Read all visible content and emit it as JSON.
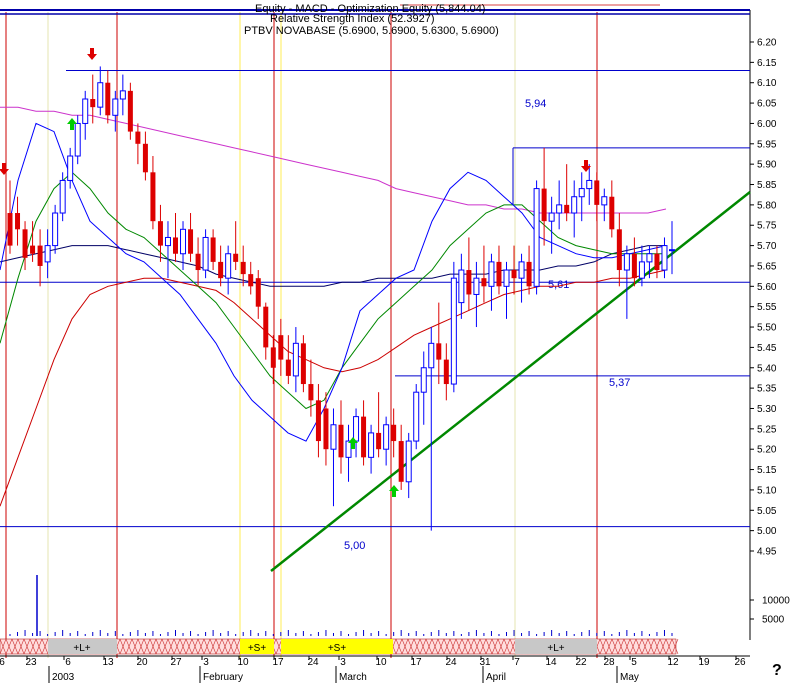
{
  "chart_data": {
    "type": "candlestick",
    "title_lines": [
      "Equity - MACD - Optimization Equity (5,844.04)",
      "Relative Strength Index (52.3927)",
      "PTBV NOVABASE (5.6900, 5.6900, 5.6300, 5.6900)"
    ],
    "y_ticks": [
      "6.20",
      "6.15",
      "6.10",
      "6.05",
      "6.00",
      "5.95",
      "5.90",
      "5.85",
      "5.80",
      "5.75",
      "5.70",
      "5.65",
      "5.60",
      "5.55",
      "5.50",
      "5.45",
      "5.40",
      "5.35",
      "5.30",
      "5.25",
      "5.20",
      "5.15",
      "5.10",
      "5.05",
      "5.00",
      "4.95"
    ],
    "ylim": [
      4.92,
      6.24
    ],
    "volume_ticks": [
      "10000",
      "5000"
    ],
    "x_day_labels": [
      "6",
      "23",
      "6",
      "13",
      "20",
      "27",
      "3",
      "10",
      "17",
      "24",
      "3",
      "10",
      "17",
      "24",
      "31",
      "7",
      "14",
      "22",
      "28",
      "5",
      "12",
      "19",
      "26"
    ],
    "x_month_labels": [
      "2003",
      "February",
      "March",
      "April",
      "May"
    ],
    "band_labels": [
      "+L+",
      "+S+",
      "+S+",
      "+L+"
    ],
    "levels": [
      {
        "value": 6.13,
        "label": ""
      },
      {
        "value": 5.94,
        "label": "5,94"
      },
      {
        "value": 5.61,
        "label": "5,61"
      },
      {
        "value": 5.38,
        "label": "5,37"
      },
      {
        "value": 5.01,
        "label": "5,00"
      }
    ],
    "trendline": {
      "start": {
        "day": 39,
        "price": 4.88
      },
      "end": {
        "day": 122,
        "price": 5.8
      }
    },
    "candles": [
      {
        "o": 5.78,
        "h": 5.86,
        "l": 5.68,
        "c": 5.7
      },
      {
        "o": 5.78,
        "h": 5.82,
        "l": 5.7,
        "c": 5.74
      },
      {
        "o": 5.74,
        "h": 5.76,
        "l": 5.64,
        "c": 5.67
      },
      {
        "o": 5.7,
        "h": 5.76,
        "l": 5.66,
        "c": 5.68
      },
      {
        "o": 5.7,
        "h": 5.74,
        "l": 5.6,
        "c": 5.65
      },
      {
        "o": 5.66,
        "h": 5.74,
        "l": 5.62,
        "c": 5.7
      },
      {
        "o": 5.7,
        "h": 5.8,
        "l": 5.68,
        "c": 5.78
      },
      {
        "o": 5.78,
        "h": 5.88,
        "l": 5.76,
        "c": 5.86
      },
      {
        "o": 5.86,
        "h": 5.94,
        "l": 5.84,
        "c": 5.92
      },
      {
        "o": 5.92,
        "h": 6.02,
        "l": 5.9,
        "c": 6.0
      },
      {
        "o": 6.0,
        "h": 6.08,
        "l": 5.96,
        "c": 6.06
      },
      {
        "o": 6.06,
        "h": 6.12,
        "l": 6.0,
        "c": 6.04
      },
      {
        "o": 6.04,
        "h": 6.14,
        "l": 6.02,
        "c": 6.1
      },
      {
        "o": 6.1,
        "h": 6.13,
        "l": 6.0,
        "c": 6.02
      },
      {
        "o": 6.02,
        "h": 6.08,
        "l": 5.98,
        "c": 6.06
      },
      {
        "o": 6.06,
        "h": 6.12,
        "l": 6.02,
        "c": 6.08
      },
      {
        "o": 6.08,
        "h": 6.1,
        "l": 5.96,
        "c": 5.98
      },
      {
        "o": 5.98,
        "h": 6.0,
        "l": 5.9,
        "c": 5.95
      },
      {
        "o": 5.95,
        "h": 5.98,
        "l": 5.86,
        "c": 5.88
      },
      {
        "o": 5.88,
        "h": 5.92,
        "l": 5.74,
        "c": 5.76
      },
      {
        "o": 5.76,
        "h": 5.8,
        "l": 5.66,
        "c": 5.7
      },
      {
        "o": 5.7,
        "h": 5.76,
        "l": 5.62,
        "c": 5.72
      },
      {
        "o": 5.72,
        "h": 5.78,
        "l": 5.66,
        "c": 5.68
      },
      {
        "o": 5.68,
        "h": 5.76,
        "l": 5.64,
        "c": 5.74
      },
      {
        "o": 5.74,
        "h": 5.78,
        "l": 5.66,
        "c": 5.68
      },
      {
        "o": 5.68,
        "h": 5.72,
        "l": 5.6,
        "c": 5.64
      },
      {
        "o": 5.64,
        "h": 5.74,
        "l": 5.62,
        "c": 5.72
      },
      {
        "o": 5.72,
        "h": 5.74,
        "l": 5.64,
        "c": 5.66
      },
      {
        "o": 5.66,
        "h": 5.7,
        "l": 5.6,
        "c": 5.62
      },
      {
        "o": 5.62,
        "h": 5.7,
        "l": 5.58,
        "c": 5.68
      },
      {
        "o": 5.68,
        "h": 5.76,
        "l": 5.64,
        "c": 5.66
      },
      {
        "o": 5.66,
        "h": 5.7,
        "l": 5.6,
        "c": 5.63
      },
      {
        "o": 5.63,
        "h": 5.66,
        "l": 5.58,
        "c": 5.6
      },
      {
        "o": 5.62,
        "h": 5.64,
        "l": 5.52,
        "c": 5.55
      },
      {
        "o": 5.55,
        "h": 5.56,
        "l": 5.42,
        "c": 5.45
      },
      {
        "o": 5.45,
        "h": 5.48,
        "l": 5.36,
        "c": 5.4
      },
      {
        "o": 5.48,
        "h": 5.52,
        "l": 5.38,
        "c": 5.42
      },
      {
        "o": 5.42,
        "h": 5.48,
        "l": 5.36,
        "c": 5.38
      },
      {
        "o": 5.38,
        "h": 5.5,
        "l": 5.34,
        "c": 5.46
      },
      {
        "o": 5.46,
        "h": 5.48,
        "l": 5.34,
        "c": 5.36
      },
      {
        "o": 5.36,
        "h": 5.42,
        "l": 5.28,
        "c": 5.32
      },
      {
        "o": 5.32,
        "h": 5.36,
        "l": 5.18,
        "c": 5.22
      },
      {
        "o": 5.3,
        "h": 5.34,
        "l": 5.16,
        "c": 5.2
      },
      {
        "o": 5.2,
        "h": 5.3,
        "l": 5.06,
        "c": 5.26
      },
      {
        "o": 5.26,
        "h": 5.32,
        "l": 5.14,
        "c": 5.18
      },
      {
        "o": 5.18,
        "h": 5.26,
        "l": 5.12,
        "c": 5.22
      },
      {
        "o": 5.22,
        "h": 5.3,
        "l": 5.18,
        "c": 5.28
      },
      {
        "o": 5.28,
        "h": 5.32,
        "l": 5.16,
        "c": 5.18
      },
      {
        "o": 5.18,
        "h": 5.26,
        "l": 5.14,
        "c": 5.24
      },
      {
        "o": 5.24,
        "h": 5.34,
        "l": 5.18,
        "c": 5.2
      },
      {
        "o": 5.2,
        "h": 5.28,
        "l": 5.16,
        "c": 5.26
      },
      {
        "o": 5.26,
        "h": 5.3,
        "l": 5.18,
        "c": 5.22
      },
      {
        "o": 5.22,
        "h": 5.26,
        "l": 5.1,
        "c": 5.12
      },
      {
        "o": 5.12,
        "h": 5.24,
        "l": 5.08,
        "c": 5.22
      },
      {
        "o": 5.22,
        "h": 5.36,
        "l": 5.2,
        "c": 5.34
      },
      {
        "o": 5.34,
        "h": 5.44,
        "l": 5.26,
        "c": 5.4
      },
      {
        "o": 5.4,
        "h": 5.5,
        "l": 5.0,
        "c": 5.46
      },
      {
        "o": 5.46,
        "h": 5.56,
        "l": 5.36,
        "c": 5.42
      },
      {
        "o": 5.42,
        "h": 5.46,
        "l": 5.32,
        "c": 5.36
      },
      {
        "o": 5.36,
        "h": 5.66,
        "l": 5.34,
        "c": 5.62
      },
      {
        "o": 5.56,
        "h": 5.68,
        "l": 5.52,
        "c": 5.64
      },
      {
        "o": 5.64,
        "h": 5.72,
        "l": 5.54,
        "c": 5.58
      },
      {
        "o": 5.58,
        "h": 5.66,
        "l": 5.5,
        "c": 5.62
      },
      {
        "o": 5.62,
        "h": 5.7,
        "l": 5.56,
        "c": 5.6
      },
      {
        "o": 5.6,
        "h": 5.68,
        "l": 5.54,
        "c": 5.66
      },
      {
        "o": 5.66,
        "h": 5.7,
        "l": 5.58,
        "c": 5.6
      },
      {
        "o": 5.6,
        "h": 5.66,
        "l": 5.52,
        "c": 5.64
      },
      {
        "o": 5.64,
        "h": 5.7,
        "l": 5.58,
        "c": 5.62
      },
      {
        "o": 5.62,
        "h": 5.68,
        "l": 5.56,
        "c": 5.66
      },
      {
        "o": 5.66,
        "h": 5.7,
        "l": 5.58,
        "c": 5.6
      },
      {
        "o": 5.6,
        "h": 5.86,
        "l": 5.58,
        "c": 5.84
      },
      {
        "o": 5.84,
        "h": 5.94,
        "l": 5.7,
        "c": 5.76
      },
      {
        "o": 5.76,
        "h": 5.82,
        "l": 5.68,
        "c": 5.78
      },
      {
        "o": 5.78,
        "h": 5.86,
        "l": 5.74,
        "c": 5.8
      },
      {
        "o": 5.8,
        "h": 5.9,
        "l": 5.76,
        "c": 5.78
      },
      {
        "o": 5.78,
        "h": 5.86,
        "l": 5.72,
        "c": 5.82
      },
      {
        "o": 5.82,
        "h": 5.88,
        "l": 5.76,
        "c": 5.84
      },
      {
        "o": 5.84,
        "h": 5.9,
        "l": 5.8,
        "c": 5.86
      },
      {
        "o": 5.86,
        "h": 5.88,
        "l": 5.76,
        "c": 5.8
      },
      {
        "o": 5.8,
        "h": 5.84,
        "l": 5.76,
        "c": 5.82
      },
      {
        "o": 5.82,
        "h": 5.86,
        "l": 5.72,
        "c": 5.74
      },
      {
        "o": 5.74,
        "h": 5.78,
        "l": 5.6,
        "c": 5.64
      },
      {
        "o": 5.64,
        "h": 5.7,
        "l": 5.52,
        "c": 5.68
      },
      {
        "o": 5.68,
        "h": 5.72,
        "l": 5.6,
        "c": 5.62
      },
      {
        "o": 5.62,
        "h": 5.7,
        "l": 5.6,
        "c": 5.66
      },
      {
        "o": 5.66,
        "h": 5.7,
        "l": 5.62,
        "c": 5.68
      },
      {
        "o": 5.68,
        "h": 5.7,
        "l": 5.62,
        "c": 5.64
      },
      {
        "o": 5.64,
        "h": 5.72,
        "l": 5.62,
        "c": 5.7
      },
      {
        "o": 5.69,
        "h": 5.76,
        "l": 5.63,
        "c": 5.69
      }
    ],
    "ma_magenta": [
      6.04,
      6.04,
      6.03,
      6.03,
      6.02,
      6.02,
      6.01,
      6.0,
      5.99,
      5.98,
      5.97,
      5.96,
      5.95,
      5.94,
      5.93,
      5.92,
      5.91,
      5.9,
      5.89,
      5.88,
      5.87,
      5.86,
      5.84,
      5.83,
      5.82,
      5.81,
      5.8,
      5.8,
      5.79,
      5.79,
      5.78,
      5.78,
      5.78,
      5.78,
      5.78,
      5.78,
      5.78,
      5.79
    ],
    "ma_navy": [
      5.66,
      5.67,
      5.68,
      5.69,
      5.7,
      5.7,
      5.7,
      5.69,
      5.68,
      5.67,
      5.66,
      5.65,
      5.63,
      5.62,
      5.61,
      5.6,
      5.6,
      5.6,
      5.6,
      5.61,
      5.61,
      5.62,
      5.62,
      5.62,
      5.62,
      5.63,
      5.63,
      5.63,
      5.64,
      5.64,
      5.64,
      5.65,
      5.65,
      5.66,
      5.68,
      5.69,
      5.7,
      5.7
    ],
    "ma_red": [
      5.06,
      5.18,
      5.3,
      5.42,
      5.52,
      5.58,
      5.6,
      5.61,
      5.62,
      5.62,
      5.61,
      5.6,
      5.59,
      5.56,
      5.52,
      5.48,
      5.44,
      5.42,
      5.4,
      5.39,
      5.4,
      5.42,
      5.45,
      5.48,
      5.5,
      5.52,
      5.54,
      5.56,
      5.58,
      5.59,
      5.6,
      5.6,
      5.61,
      5.61,
      5.62,
      5.62,
      5.63,
      5.64
    ],
    "ma_green": [
      5.46,
      5.62,
      5.76,
      5.84,
      5.88,
      5.84,
      5.78,
      5.74,
      5.72,
      5.68,
      5.64,
      5.6,
      5.56,
      5.5,
      5.44,
      5.38,
      5.34,
      5.3,
      5.32,
      5.4,
      5.46,
      5.52,
      5.56,
      5.6,
      5.64,
      5.7,
      5.74,
      5.78,
      5.8,
      5.8,
      5.76,
      5.72,
      5.7,
      5.69,
      5.68,
      5.68,
      5.68,
      5.68
    ],
    "ma_blue": [
      5.64,
      5.86,
      6.0,
      5.98,
      5.86,
      5.76,
      5.72,
      5.68,
      5.66,
      5.62,
      5.58,
      5.52,
      5.46,
      5.38,
      5.32,
      5.28,
      5.24,
      5.22,
      5.3,
      5.4,
      5.54,
      5.58,
      5.62,
      5.64,
      5.76,
      5.84,
      5.88,
      5.86,
      5.82,
      5.78,
      5.72,
      5.7,
      5.68,
      5.67,
      5.67,
      5.68,
      5.69,
      5.7
    ]
  }
}
